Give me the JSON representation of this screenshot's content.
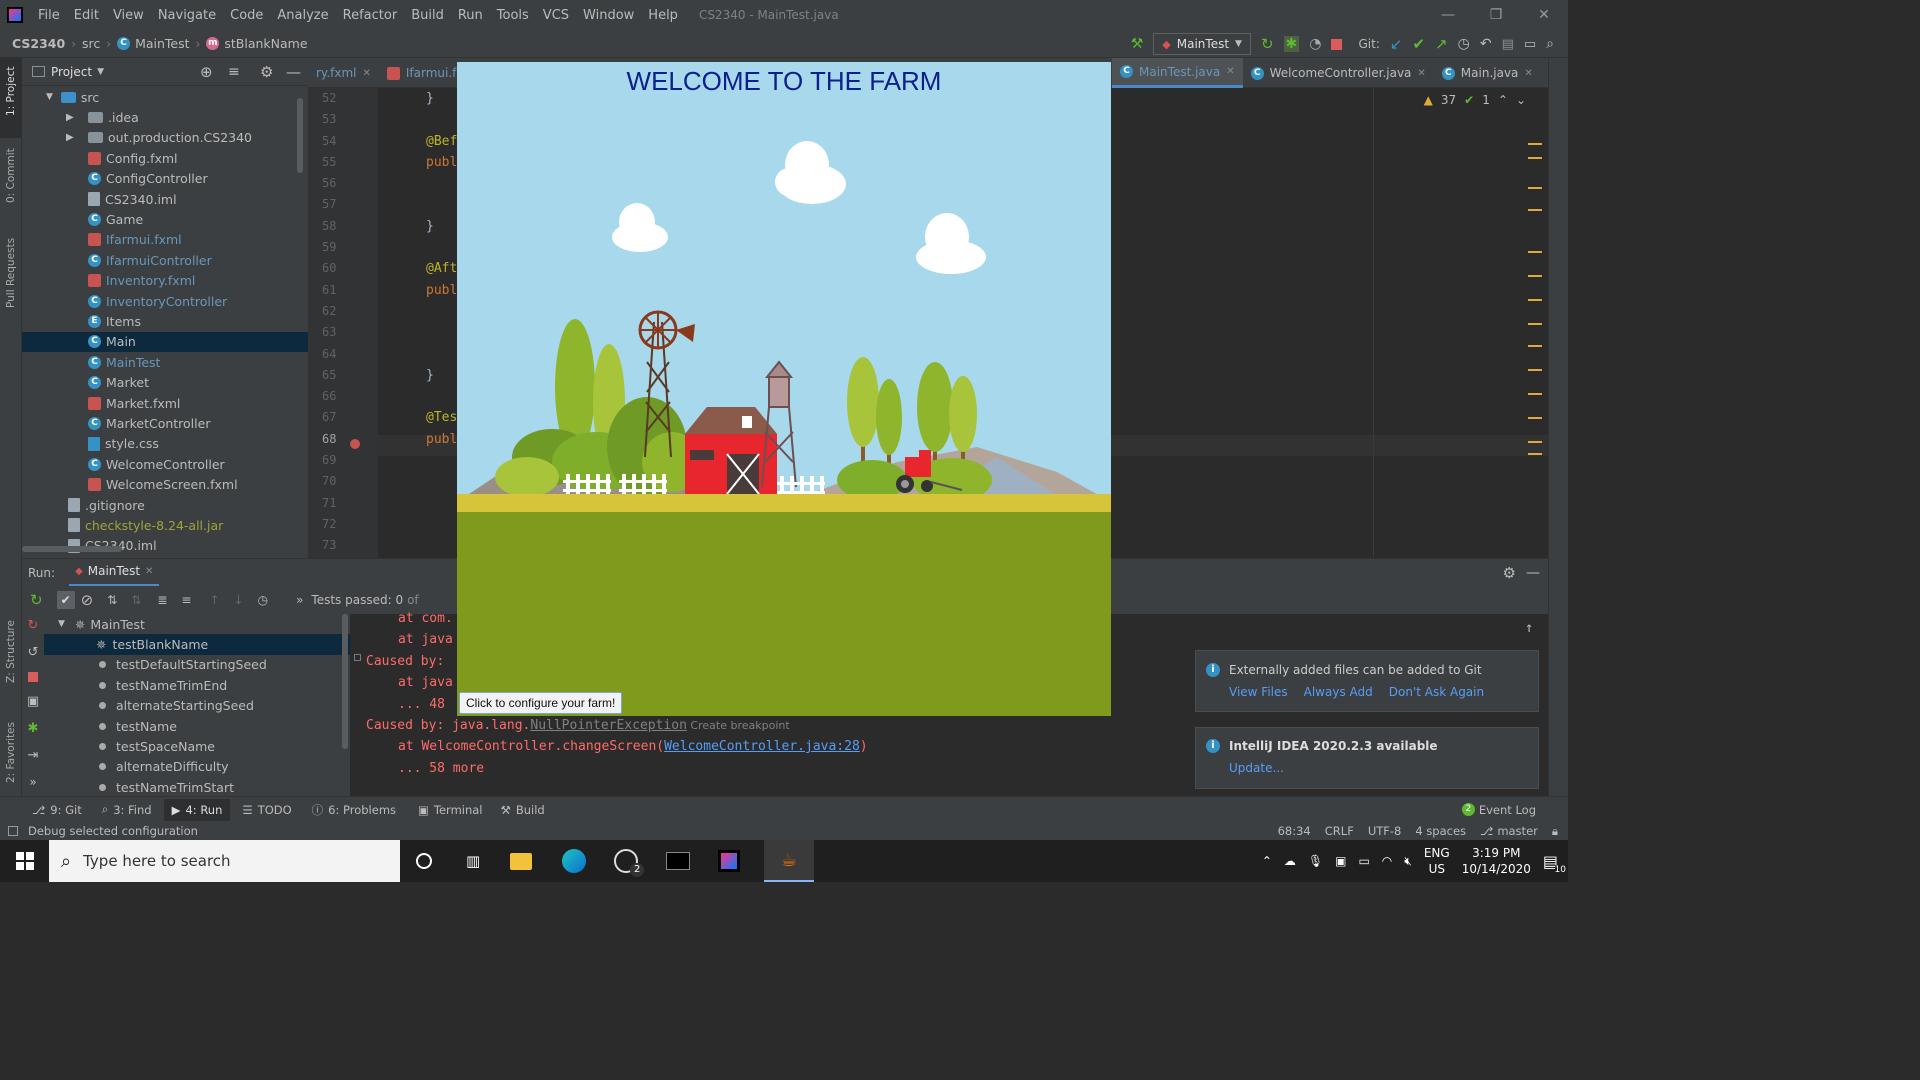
{
  "menu": [
    "File",
    "Edit",
    "View",
    "Navigate",
    "Code",
    "Analyze",
    "Refactor",
    "Build",
    "Run",
    "Tools",
    "VCS",
    "Window",
    "Help"
  ],
  "window_title": "CS2340 - MainTest.java",
  "breadcrumb": {
    "project": "CS2340",
    "folder": "src",
    "cls": "MainTest",
    "method": "stBlankName"
  },
  "run_config": "MainTest",
  "git_label": "Git:",
  "project_panel": {
    "title": "Project",
    "root": "src",
    "items": [
      {
        "label": ".idea",
        "kind": "folder",
        "color": "#bbbbbb"
      },
      {
        "label": "out.production.CS2340",
        "kind": "folder",
        "color": "#bbbbbb"
      },
      {
        "label": "Config.fxml",
        "kind": "fxml",
        "color": "#bbbbbb"
      },
      {
        "label": "ConfigController",
        "kind": "class",
        "color": "#bbbbbb"
      },
      {
        "label": "CS2340.iml",
        "kind": "file",
        "color": "#bbbbbb"
      },
      {
        "label": "Game",
        "kind": "class",
        "color": "#bbbbbb"
      },
      {
        "label": "Ifarmui.fxml",
        "kind": "fxml",
        "color": "#6897bb"
      },
      {
        "label": "IfarmuiController",
        "kind": "class",
        "color": "#6897bb"
      },
      {
        "label": "Inventory.fxml",
        "kind": "fxml",
        "color": "#6897bb"
      },
      {
        "label": "InventoryController",
        "kind": "class",
        "color": "#6897bb"
      },
      {
        "label": "Items",
        "kind": "enum",
        "color": "#bbbbbb"
      },
      {
        "label": "Main",
        "kind": "class",
        "color": "#bbbbbb"
      },
      {
        "label": "MainTest",
        "kind": "class",
        "color": "#6897bb"
      },
      {
        "label": "Market",
        "kind": "class",
        "color": "#bbbbbb"
      },
      {
        "label": "Market.fxml",
        "kind": "fxml",
        "color": "#bbbbbb"
      },
      {
        "label": "MarketController",
        "kind": "class",
        "color": "#bbbbbb"
      },
      {
        "label": "style.css",
        "kind": "css",
        "color": "#bbbbbb"
      },
      {
        "label": "WelcomeController",
        "kind": "class",
        "color": "#bbbbbb"
      },
      {
        "label": "WelcomeScreen.fxml",
        "kind": "fxml",
        "color": "#bbbbbb"
      }
    ],
    "root_items": [
      {
        "label": ".gitignore",
        "color": "#bbbbbb"
      },
      {
        "label": "checkstyle-8.24-all.jar",
        "color": "#a2a237"
      },
      {
        "label": "CS2340.iml",
        "color": "#bbbbbb"
      }
    ]
  },
  "left_stripe": [
    "1: Project",
    "0: Commit",
    "Pull Requests"
  ],
  "left_stripe_bottom": [
    "Z: Structure",
    "2: Favorites"
  ],
  "editor_tabs": [
    {
      "label": "ry.fxml",
      "active": false
    },
    {
      "label": "Ifarmui.fxm",
      "active": false
    },
    {
      "label": "MainTest.java",
      "active": true
    },
    {
      "label": "WelcomeController.java",
      "active": false
    },
    {
      "label": "Main.java",
      "active": false
    }
  ],
  "inspections": {
    "warnings": "37",
    "ok": "1"
  },
  "line_numbers": [
    "52",
    "53",
    "54",
    "55",
    "56",
    "57",
    "58",
    "59",
    "60",
    "61",
    "62",
    "63",
    "64",
    "65",
    "66",
    "67",
    "68",
    "69",
    "70",
    "71",
    "72",
    "73"
  ],
  "code_lines": [
    "}",
    "",
    "@Bef",
    "publ",
    "",
    "",
    "}",
    "",
    "@Aft",
    "publ",
    "",
    "",
    "",
    "}",
    "",
    "@Tes",
    "publ",
    "",
    "",
    "",
    "",
    ""
  ],
  "run": {
    "label": "Run:",
    "tab": "MainTest",
    "tests_passed": "Tests passed: 0",
    "tests_of": "of",
    "root": "MainTest",
    "tests": [
      "testBlankName",
      "testDefaultStartingSeed",
      "testNameTrimEnd",
      "alternateStartingSeed",
      "testName",
      "testSpaceName",
      "alternateDifficulty",
      "testNameTrimStart"
    ]
  },
  "console": {
    "l1": "at com.",
    "l2": "at java",
    "l3a": "Caused by:",
    "l4": "at java",
    "l5": "... 48",
    "l6a": "Caused by: java.lang.",
    "l6b": "NullPointerException",
    "l6c": " Create breakpoint",
    "l7a": "at WelcomeController.changeScreen(",
    "l7b": "WelcomeController.java:28",
    "l7c": ")",
    "l8": "... 58 more"
  },
  "farm_window": {
    "title": "WELCOME TO THE FARM",
    "button": "Click to configure your farm!",
    "colors": {
      "sky": "#a8d8ec",
      "ground": "#7f9a1c",
      "horizon": "#d6c43a"
    }
  },
  "notifications": {
    "git": {
      "text": "Externally added files can be added to Git",
      "actions": [
        "View Files",
        "Always Add",
        "Don't Ask Again"
      ]
    },
    "update": {
      "text": "IntelliJ IDEA 2020.2.3 available",
      "action": "Update..."
    }
  },
  "tool_windows": [
    "9: Git",
    "3: Find",
    "4: Run",
    "TODO",
    "6: Problems",
    "Terminal",
    "Build"
  ],
  "event_log": {
    "count": "2",
    "label": "Event Log"
  },
  "status": {
    "message": "Debug selected configuration",
    "position": "68:34",
    "line_sep": "CRLF",
    "encoding": "UTF-8",
    "indent": "4 spaces",
    "branch": "master"
  },
  "taskbar": {
    "search": "Type here to search",
    "lang": "ENG",
    "region": "US",
    "time": "3:19 PM",
    "date": "10/14/2020",
    "badge": "2",
    "notif_count": "10"
  }
}
